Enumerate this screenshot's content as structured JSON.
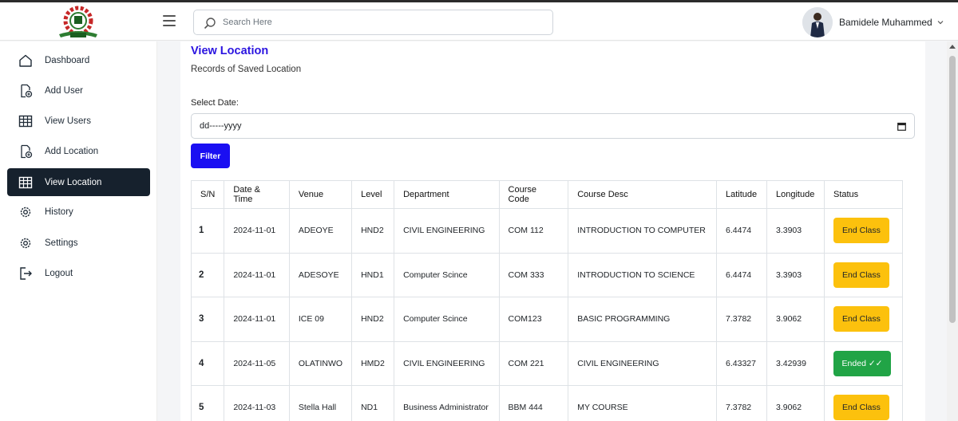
{
  "header": {
    "search_placeholder": "Search Here",
    "user_name": "Bamidele Muhammed"
  },
  "sidebar": {
    "items": [
      {
        "label": "Dashboard",
        "icon": "home-icon"
      },
      {
        "label": "Add User",
        "icon": "add-file-icon"
      },
      {
        "label": "View Users",
        "icon": "table-icon"
      },
      {
        "label": "Add Location",
        "icon": "add-file-icon"
      },
      {
        "label": "View Location",
        "icon": "table-icon",
        "active": true
      },
      {
        "label": "History",
        "icon": "gear-icon"
      },
      {
        "label": "Settings",
        "icon": "gear-icon"
      },
      {
        "label": "Logout",
        "icon": "logout-icon"
      }
    ]
  },
  "main": {
    "title": "View Location",
    "subtitle": "Records of Saved Location",
    "date_label": "Select Date:",
    "date_value": "dd-----yyyy",
    "filter_label": "Filter",
    "table": {
      "headers": [
        "S/N",
        "Date & Time",
        "Venue",
        "Level",
        "Department",
        "Course Code",
        "Course Desc",
        "Latitude",
        "Longitude",
        "Status"
      ],
      "rows": [
        {
          "sn": "1",
          "date": "2024-11-01",
          "venue": "ADEOYE",
          "level": "HND2",
          "department": "CIVIL ENGINEERING",
          "code": "COM 112",
          "desc": "INTRODUCTION TO COMPUTER",
          "lat": "6.4474",
          "lng": "3.3903",
          "status": "End Class",
          "status_type": "end"
        },
        {
          "sn": "2",
          "date": "2024-11-01",
          "venue": "ADESOYE",
          "level": "HND1",
          "department": "Computer Scince",
          "code": "COM 333",
          "desc": "INTRODUCTION TO SCIENCE",
          "lat": "6.4474",
          "lng": "3.3903",
          "status": "End Class",
          "status_type": "end"
        },
        {
          "sn": "3",
          "date": "2024-11-01",
          "venue": "ICE 09",
          "level": "HND2",
          "department": "Computer Scince",
          "code": "COM123",
          "desc": "BASIC PROGRAMMING",
          "lat": "7.3782",
          "lng": "3.9062",
          "status": "End Class",
          "status_type": "end"
        },
        {
          "sn": "4",
          "date": "2024-11-05",
          "venue": "OLATINWO",
          "level": "HMD2",
          "department": "CIVIL ENGINEERING",
          "code": "COM 221",
          "desc": "CIVIL ENGINEERING",
          "lat": "6.43327",
          "lng": "3.42939",
          "status": "Ended ✓✓",
          "status_type": "ended"
        },
        {
          "sn": "5",
          "date": "2024-11-03",
          "venue": "Stella Hall",
          "level": "ND1",
          "department": "Business Administrator",
          "code": "BBM 444",
          "desc": "MY COURSE",
          "lat": "7.3782",
          "lng": "3.9062",
          "status": "End Class",
          "status_type": "end"
        }
      ]
    }
  },
  "colors": {
    "accent": "#1a0ff2",
    "sidebar_active": "#16212d",
    "end_class": "#fcc10d",
    "ended": "#21a446"
  }
}
